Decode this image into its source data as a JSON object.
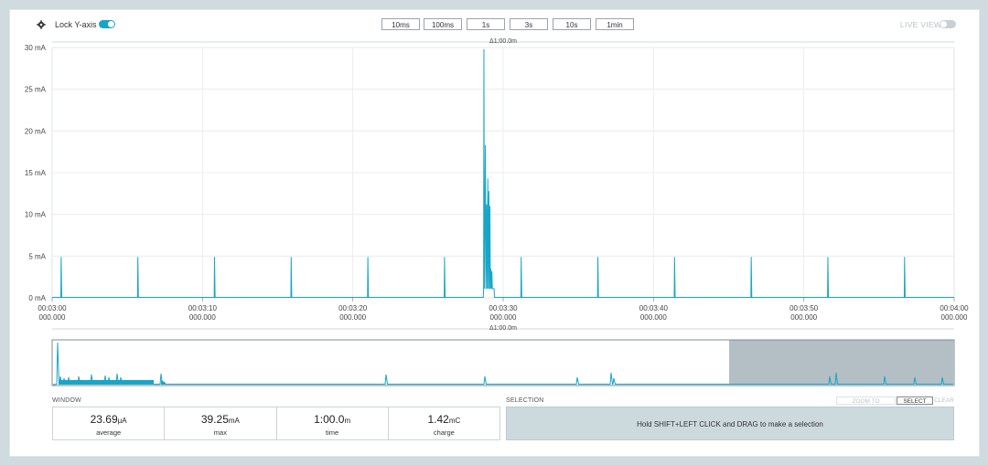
{
  "toolbar": {
    "lock_label": "Lock Y-axis",
    "lock_on": true,
    "zoom_buttons": [
      "10ms",
      "100ms",
      "1s",
      "3s",
      "10s",
      "1min"
    ],
    "live_label": "LIVE VIEW",
    "live_on": false
  },
  "chart_data": {
    "type": "line",
    "delta_label": "Δ1:00.0m",
    "ylim": [
      0,
      30
    ],
    "y_unit": "mA",
    "y_ticks": [
      "0 mA",
      "5 mA",
      "10 mA",
      "15 mA",
      "20 mA",
      "25 mA",
      "30 mA"
    ],
    "y_tick_values": [
      0,
      5,
      10,
      15,
      20,
      25,
      30
    ],
    "xlim_seconds": [
      180,
      240
    ],
    "x_tick_values": [
      180,
      190,
      200,
      210,
      220,
      230,
      240
    ],
    "x_ticks": [
      [
        "00:03:00",
        "000.000"
      ],
      [
        "00:03:10",
        "000.000"
      ],
      [
        "00:03:20",
        "000.000"
      ],
      [
        "00:03:30",
        "000.000"
      ],
      [
        "00:03:40",
        "000.000"
      ],
      [
        "00:03:50",
        "000.000"
      ],
      [
        "00:04:00",
        "000.000"
      ]
    ],
    "series": [
      {
        "color": "#19a5c8",
        "baseline": 0.05,
        "periodic_spikes": {
          "times": [
            180.6,
            185.7,
            190.8,
            195.9,
            201.0,
            206.1,
            211.2,
            216.3,
            221.4,
            226.5,
            231.6,
            236.7
          ],
          "peak": 4.9
        },
        "burst": {
          "start": 208.7,
          "end": 209.4,
          "floor": 1.1,
          "peaks": [
            [
              208.72,
              29.8
            ],
            [
              208.82,
              18.3
            ],
            [
              208.9,
              11.2
            ],
            [
              208.98,
              14.3
            ],
            [
              209.05,
              12.8
            ],
            [
              209.12,
              11.0
            ],
            [
              209.18,
              3.5
            ],
            [
              209.25,
              3.2
            ]
          ]
        }
      }
    ]
  },
  "overview": {
    "delta_label": "Δ1:00.0m"
  },
  "window": {
    "title": "WINDOW",
    "stats": [
      {
        "value": "23.69",
        "unit": "μA",
        "label": "average"
      },
      {
        "value": "39.25",
        "unit": "mA",
        "label": "max"
      },
      {
        "value": "1:00.0",
        "unit": "m",
        "label": "time"
      },
      {
        "value": "1.42",
        "unit": "mC",
        "label": "charge"
      }
    ]
  },
  "selection": {
    "title": "SELECTION",
    "zoom_label": "ZOOM TO SELECTION",
    "select_all_label": "SELECT ALL",
    "clear_label": "CLEAR",
    "hint": "Hold SHIFT+LEFT CLICK and DRAG to make a selection"
  }
}
